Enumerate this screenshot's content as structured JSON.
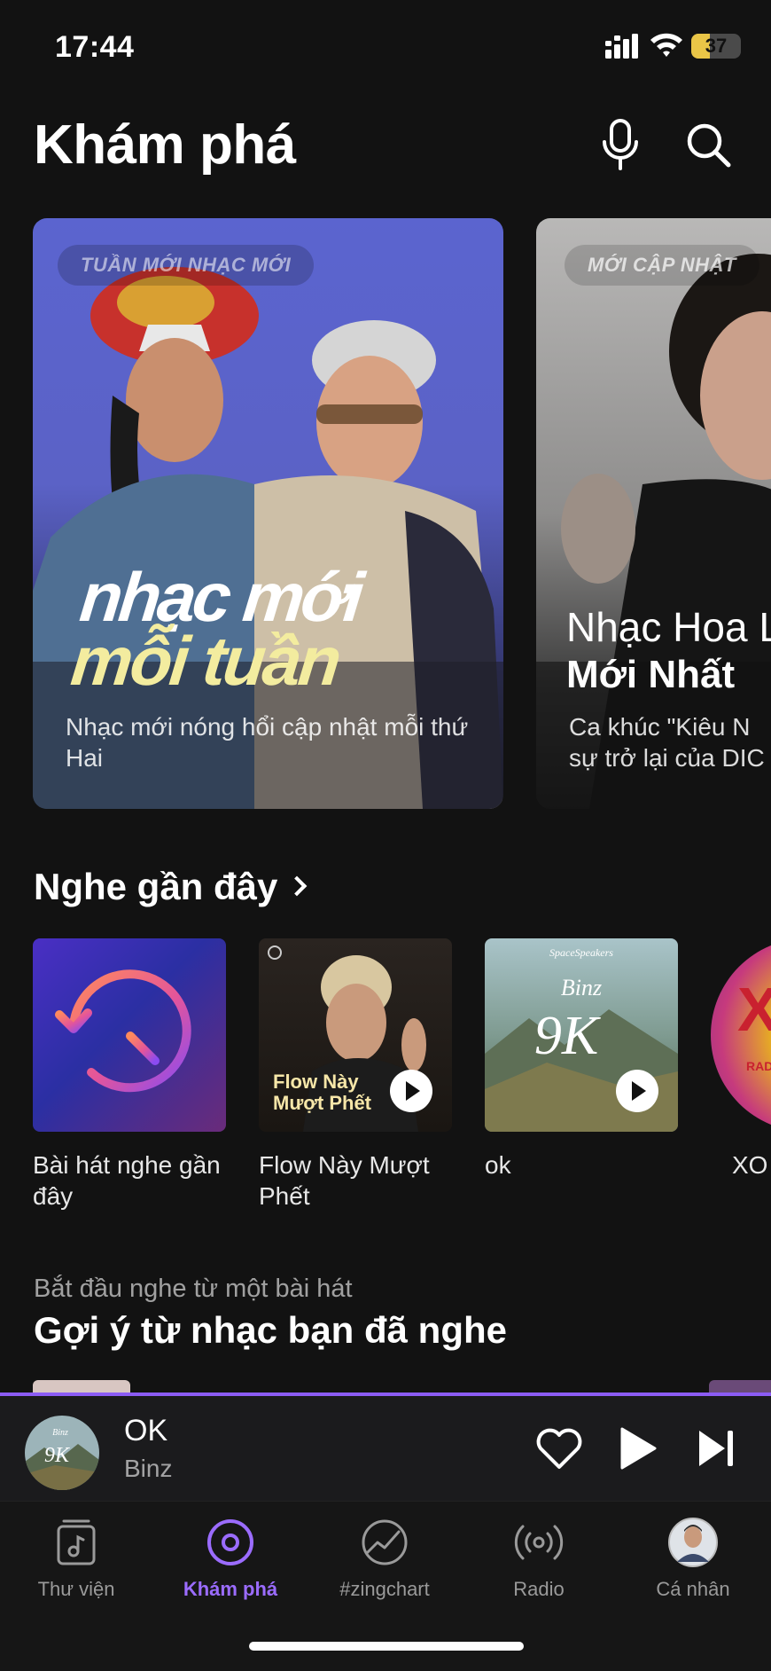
{
  "status_bar": {
    "time": "17:44",
    "battery_percent": "37",
    "battery_level": 0.37
  },
  "header": {
    "title": "Khám phá",
    "mic_icon": "microphone-icon",
    "search_icon": "search-icon"
  },
  "banners": [
    {
      "tag": "TUẦN MỚI NHẠC MỚI",
      "headline_1": "nhạc mới",
      "headline_2": "mỗi tuần",
      "description": "Nhạc mới nóng hổi cập nhật mỗi thứ Hai"
    },
    {
      "tag": "MỚI CẬP NHẬT",
      "headline_1": "Nhạc Hoa L",
      "headline_2": "Mới Nhất",
      "description_1": "Ca khúc \"Kiêu N",
      "description_2": "sự trở lại của DIC"
    }
  ],
  "recent": {
    "title": "Nghe gần đây",
    "items": [
      {
        "label": "Bài hát nghe gần đây",
        "icon": "history-icon"
      },
      {
        "label": "Flow Này Mượt Phết",
        "cover_text_1": "Flow Này",
        "cover_text_2": "Mượt Phết"
      },
      {
        "label": "ok",
        "cover_brand": "SpaceSpeakers",
        "cover_artist": "Binz",
        "cover_title": "9K"
      },
      {
        "label": "XO",
        "cover_text": "X",
        "cover_sub": "RADI"
      }
    ]
  },
  "suggestions": {
    "subtitle": "Bắt đầu nghe từ một bài hát",
    "title": "Gợi ý từ nhạc bạn đã nghe"
  },
  "player": {
    "title": "OK",
    "artist": "Binz",
    "cover_title": "9K",
    "cover_artist": "Binz",
    "progress": 1.0
  },
  "nav": [
    {
      "label": "Thư viện",
      "icon": "library-icon",
      "active": false
    },
    {
      "label": "Khám phá",
      "icon": "discover-icon",
      "active": true
    },
    {
      "label": "#zingchart",
      "icon": "zingchart-icon",
      "active": false
    },
    {
      "label": "Radio",
      "icon": "radio-icon",
      "active": false
    },
    {
      "label": "Cá nhân",
      "icon": "profile-avatar-icon",
      "active": false
    }
  ],
  "colors": {
    "accent": "#9b6cff",
    "background": "#121212",
    "player_bg": "#1b1b1d",
    "banner_1": "#5b64cf"
  }
}
